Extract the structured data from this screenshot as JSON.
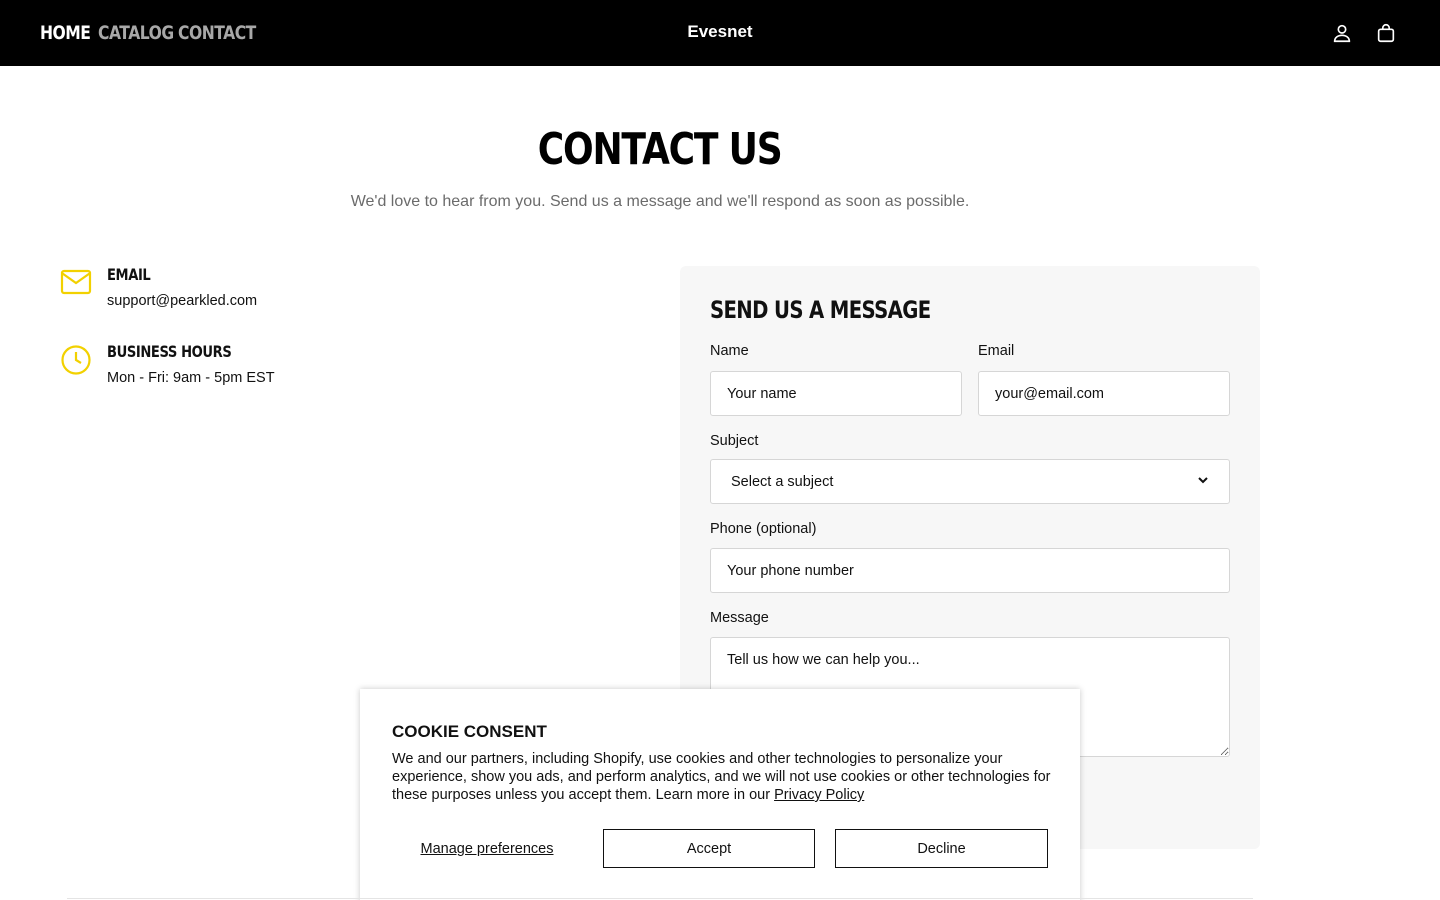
{
  "header": {
    "nav": [
      {
        "label": "HOME",
        "active": true
      },
      {
        "label": "CATALOG",
        "active": false
      },
      {
        "label": "CONTACT",
        "active": false
      }
    ],
    "brand": "Evesnet",
    "icons": [
      "account-icon",
      "cart-icon"
    ]
  },
  "hero": {
    "title": "CONTACT US",
    "subtitle": "We'd love to hear from you. Send us a message and we'll respond as soon as possible."
  },
  "info": {
    "email": {
      "title": "EMAIL",
      "value": "support@pearkled.com",
      "icon": "mail-icon"
    },
    "hours": {
      "title": "BUSINESS HOURS",
      "value": "Mon - Fri: 9am - 5pm EST",
      "icon": "clock-icon"
    }
  },
  "form": {
    "title": "SEND US A MESSAGE",
    "name_label": "Name",
    "name_placeholder": "Your name",
    "email_label": "Email",
    "email_placeholder": "your@email.com",
    "subject_label": "Subject",
    "subject_selected": "Select a subject",
    "phone_label": "Phone (optional)",
    "phone_placeholder": "Your phone number",
    "message_label": "Message",
    "message_placeholder": "Tell us how we can help you..."
  },
  "cookie": {
    "title": "COOKIE CONSENT",
    "text": "We and our partners, including Shopify, use cookies and other technologies to personalize your experience, show you ads, and perform analytics, and we will not use cookies or other technologies for these purposes unless you accept them. Learn more in our ",
    "policy_link": "Privacy Policy",
    "manage": "Manage preferences",
    "accept": "Accept",
    "decline": "Decline"
  },
  "colors": {
    "header_bg": "#000000",
    "accent_icon": "#F2D100",
    "card_bg": "#F7F7F7",
    "nav_dim": "#A8A8A8",
    "subtitle": "#6B6B6B"
  }
}
